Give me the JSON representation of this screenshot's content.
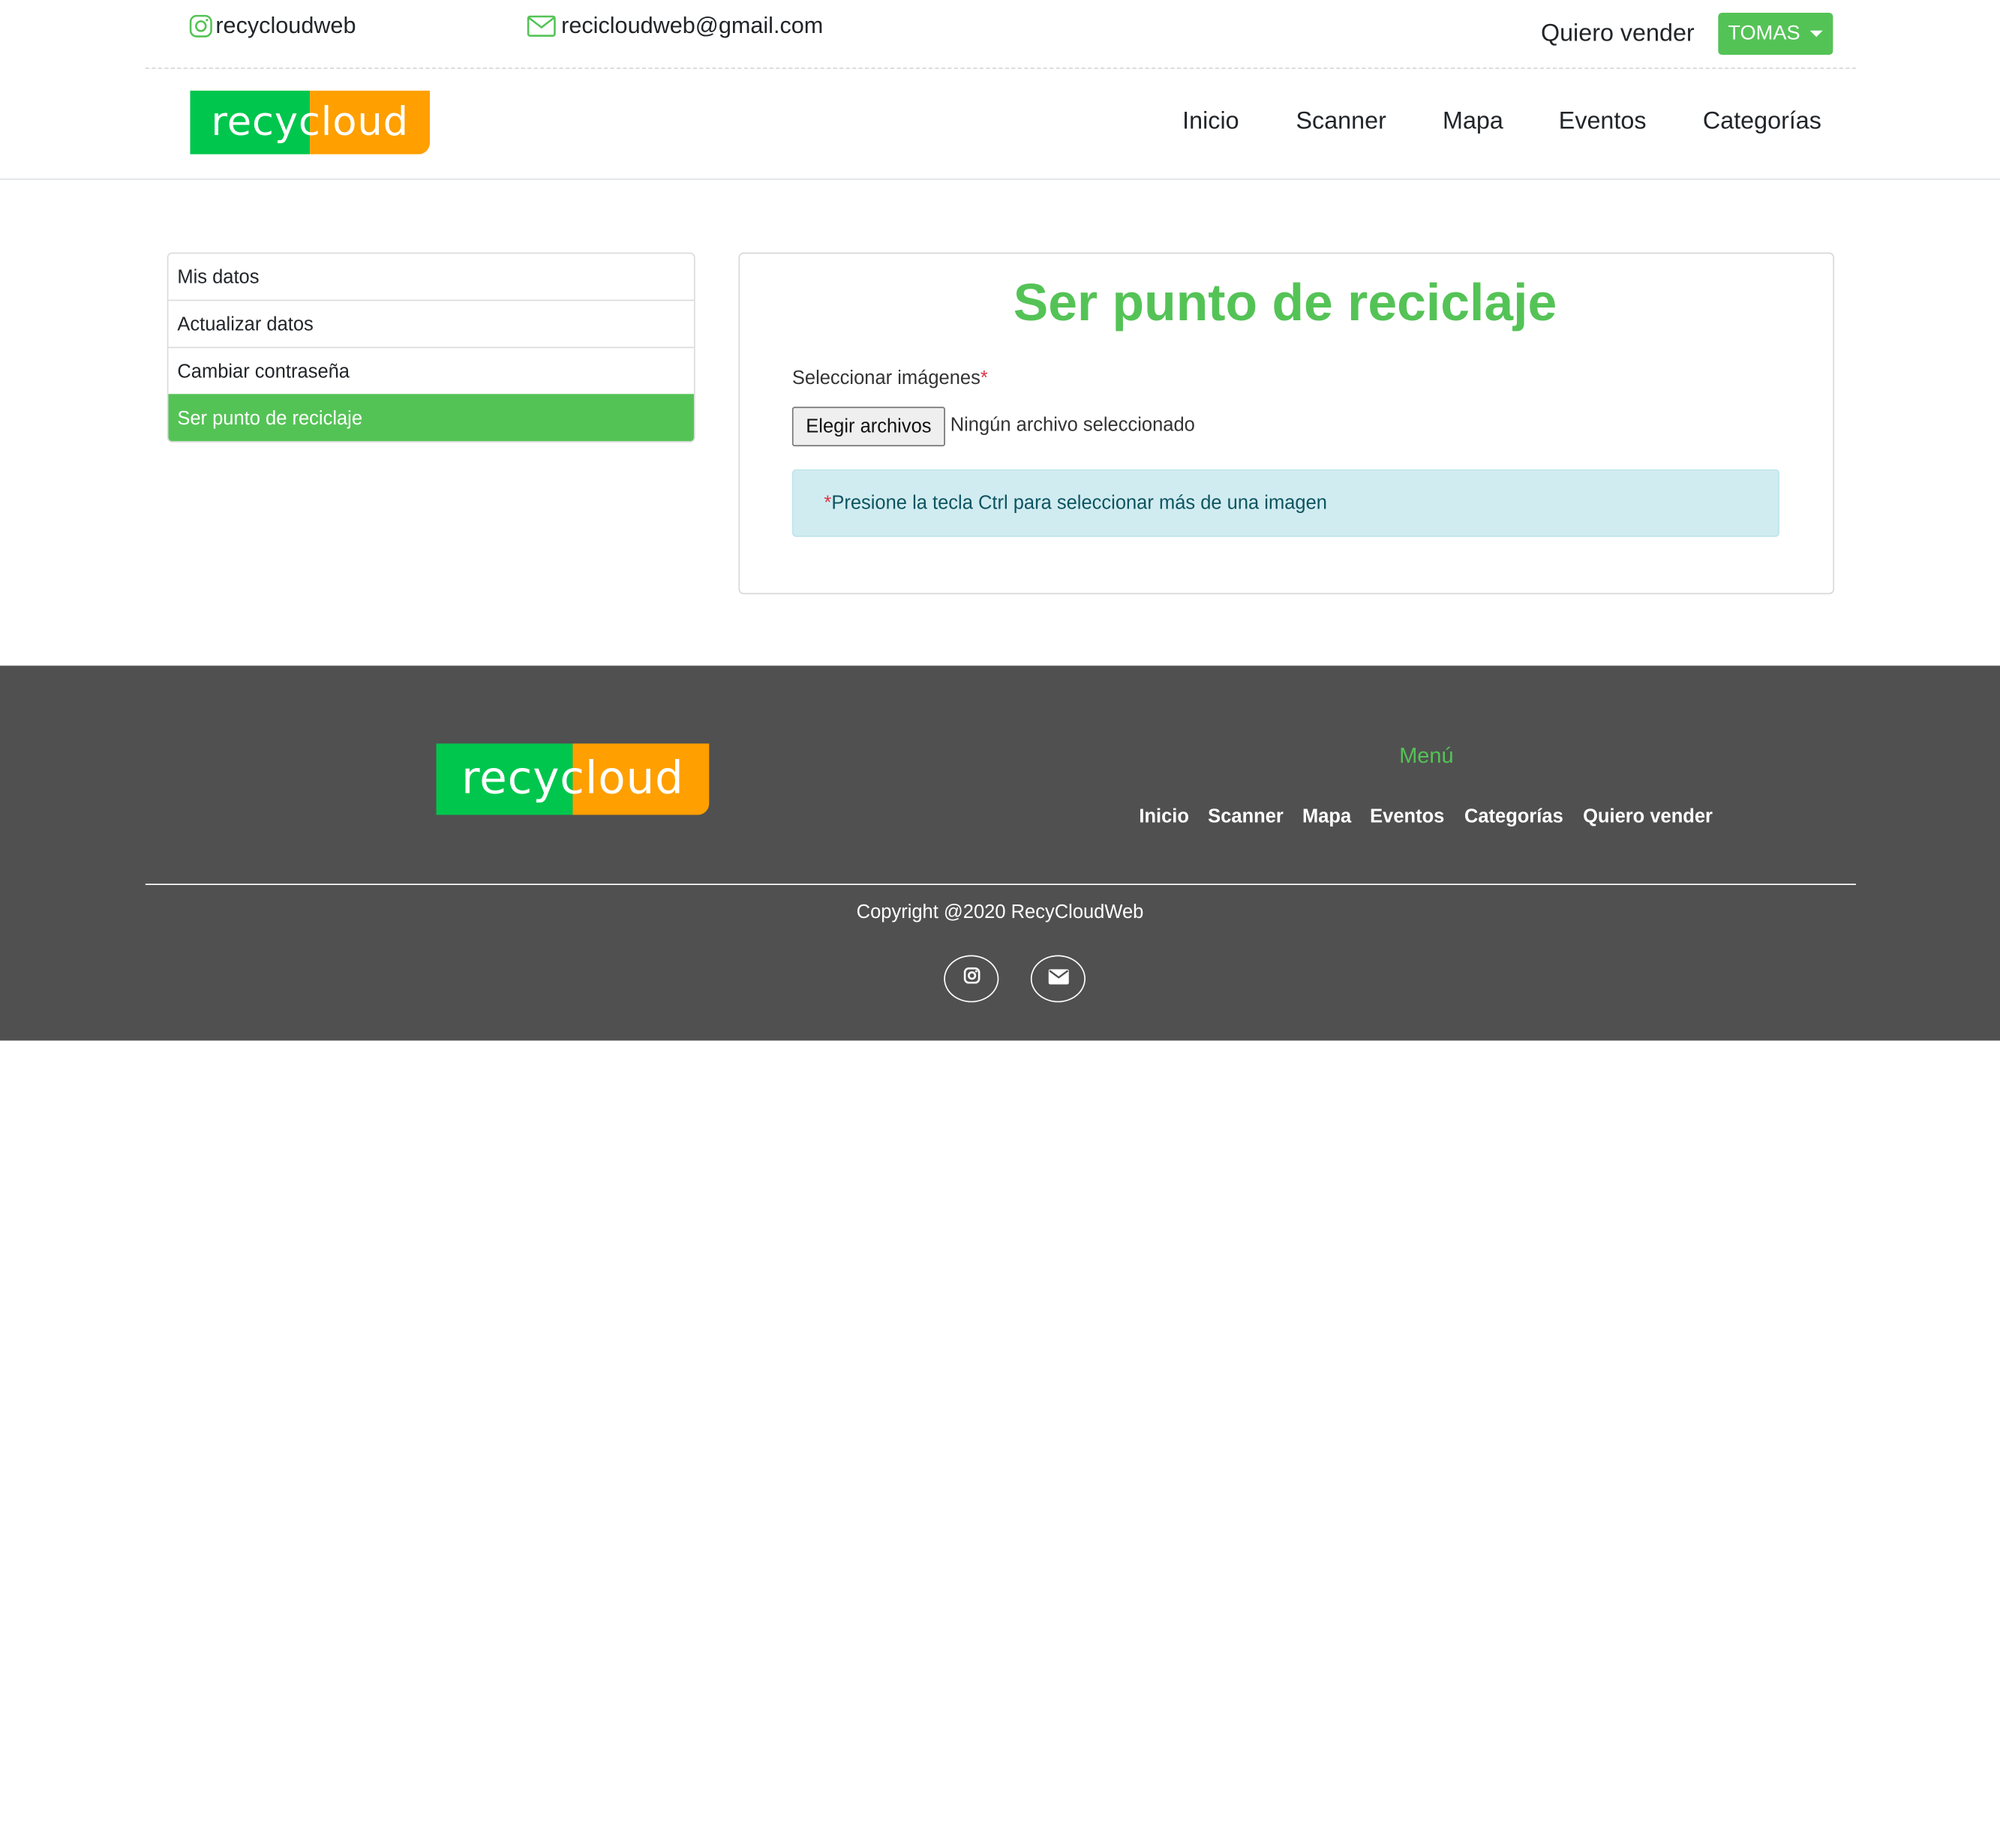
{
  "contact": {
    "instagram_handle": "recycloudweb",
    "email": "recicloudweb@gmail.com"
  },
  "header": {
    "sell_link": "Quiero vender",
    "user_name": "TOMAS",
    "logo_text": "recycloud",
    "nav": [
      "Inicio",
      "Scanner",
      "Mapa",
      "Eventos",
      "Categorías"
    ]
  },
  "sidebar": {
    "items": [
      {
        "label": "Mis datos",
        "active": false
      },
      {
        "label": "Actualizar datos",
        "active": false
      },
      {
        "label": "Cambiar contraseña",
        "active": false
      },
      {
        "label": "Ser punto de reciclaje",
        "active": true
      }
    ]
  },
  "form": {
    "title": "Ser punto de reciclaje",
    "images_label": "Seleccionar imágenes",
    "required_mark": "*",
    "file_button": "Elegir archivos",
    "file_status": "Ningún archivo seleccionado",
    "hint_mark": "*",
    "hint": "Presione la tecla Ctrl para seleccionar más de una imagen"
  },
  "footer": {
    "logo_text": "recycloud",
    "menu_title": "Menú",
    "links": [
      "Inicio",
      "Scanner",
      "Mapa",
      "Eventos",
      "Categorías",
      "Quiero vender"
    ],
    "copyright": "Copyright @2020 RecyCloudWeb"
  },
  "colors": {
    "brand_green": "#54c356",
    "logo_green": "#00c64d",
    "logo_orange": "#ff9f00",
    "footer_bg": "#505050",
    "alert_bg": "#d1ecf1"
  },
  "icons": [
    "instagram-icon",
    "mail-icon",
    "caret-down-icon",
    "instagram-icon",
    "envelope-icon"
  ]
}
